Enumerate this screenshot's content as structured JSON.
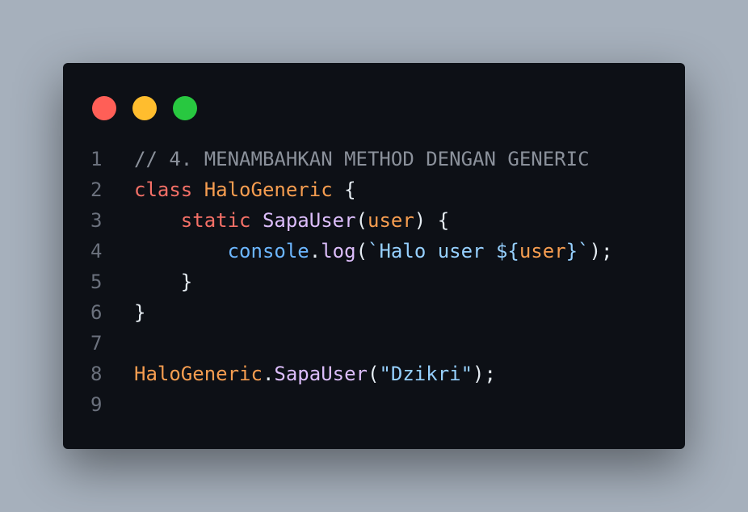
{
  "window": {
    "traffic_lights": [
      "close",
      "minimize",
      "maximize"
    ],
    "colors": {
      "close": "#ff5f57",
      "minimize": "#ffbd2e",
      "maximize": "#28c840",
      "background": "#0d1016",
      "page_background": "#a6b0bc"
    }
  },
  "code": {
    "line_numbers": [
      "1",
      "2",
      "3",
      "4",
      "5",
      "6",
      "7",
      "8",
      "9"
    ],
    "lines": [
      [
        {
          "t": "// 4. MENAMBAHKAN METHOD DENGAN GENERIC",
          "c": "comment"
        }
      ],
      [
        {
          "t": "class",
          "c": "keyword"
        },
        {
          "t": " ",
          "c": "punc"
        },
        {
          "t": "HaloGeneric",
          "c": "class"
        },
        {
          "t": " {",
          "c": "punc"
        }
      ],
      [
        {
          "t": "    ",
          "c": "punc"
        },
        {
          "t": "static",
          "c": "keyword"
        },
        {
          "t": " ",
          "c": "punc"
        },
        {
          "t": "SapaUser",
          "c": "func"
        },
        {
          "t": "(",
          "c": "punc"
        },
        {
          "t": "user",
          "c": "param"
        },
        {
          "t": ") {",
          "c": "punc"
        }
      ],
      [
        {
          "t": "        ",
          "c": "punc"
        },
        {
          "t": "console",
          "c": "obj"
        },
        {
          "t": ".",
          "c": "punc"
        },
        {
          "t": "log",
          "c": "func"
        },
        {
          "t": "(",
          "c": "punc"
        },
        {
          "t": "`Halo user ${",
          "c": "string"
        },
        {
          "t": "user",
          "c": "interp"
        },
        {
          "t": "}`",
          "c": "string"
        },
        {
          "t": ");",
          "c": "punc"
        }
      ],
      [
        {
          "t": "    }",
          "c": "punc"
        }
      ],
      [
        {
          "t": "}",
          "c": "punc"
        }
      ],
      [],
      [
        {
          "t": "HaloGeneric",
          "c": "class"
        },
        {
          "t": ".",
          "c": "punc"
        },
        {
          "t": "SapaUser",
          "c": "func"
        },
        {
          "t": "(",
          "c": "punc"
        },
        {
          "t": "\"Dzikri\"",
          "c": "string"
        },
        {
          "t": ");",
          "c": "punc"
        }
      ],
      []
    ]
  }
}
